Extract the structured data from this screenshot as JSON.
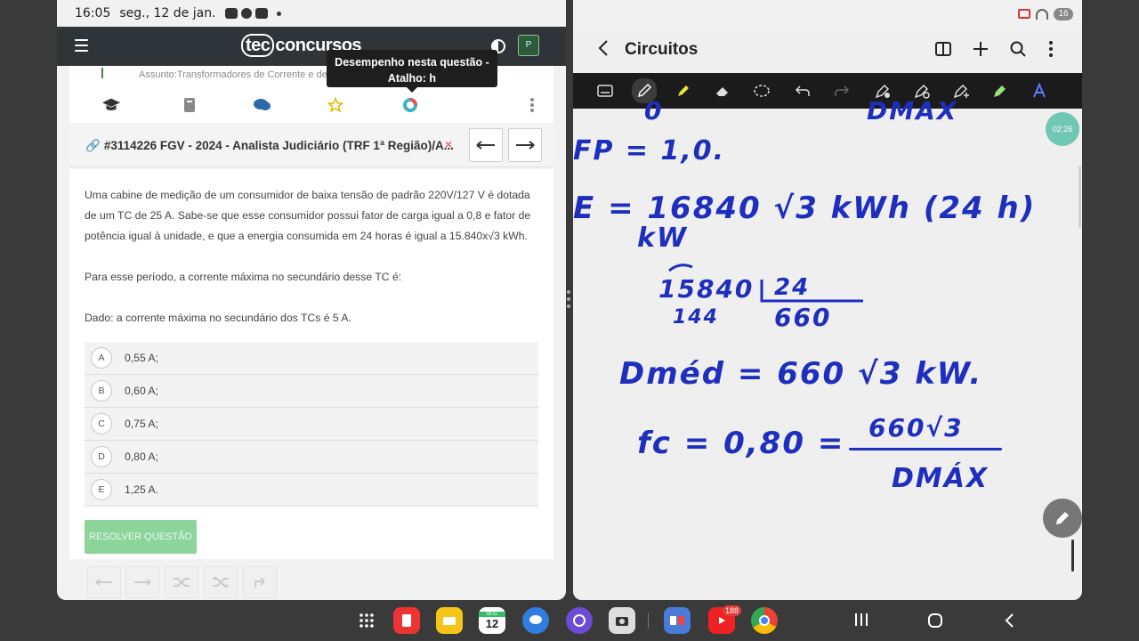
{
  "left_app": {
    "status": {
      "time": "16:05",
      "date": "seg., 12 de jan."
    },
    "brand": {
      "tec": "tec",
      "rest": "concursos"
    },
    "avatar_letter": "P",
    "tooltip": {
      "line1": "Desempenho nesta questão -",
      "line2": "Atalho: h"
    },
    "assunto": "Assunto:Transformadores de Corrente e de",
    "tab_icons": [
      "graduation-cap-icon",
      "book-icon",
      "comments-icon",
      "star-icon",
      "performance-ring-icon"
    ],
    "question": {
      "title": "#3114226 FGV - 2024 - Analista Judiciário (TRF 1ª Região)/A...",
      "close": "×",
      "paragraphs": [
        "Uma cabine de medição de um consumidor de baixa tensão de padrão 220V/127 V é dotada de um TC de 25 A. Sabe-se que esse consumidor possui fator de carga igual a 0,8 e fator de potência igual à unidade, e que a energia consumida em 24 horas é igual a 15.840x√3 kWh.",
        "Para esse período, a corrente máxima no secundário desse TC é:",
        "Dado: a corrente máxima no secundário dos TCs é 5 A."
      ],
      "alternatives": [
        {
          "letter": "A",
          "text": "0,55 A;"
        },
        {
          "letter": "B",
          "text": "0,60 A;"
        },
        {
          "letter": "C",
          "text": "0,75 A;"
        },
        {
          "letter": "D",
          "text": "0,80 A;"
        },
        {
          "letter": "E",
          "text": "1,25 A."
        }
      ],
      "resolve_label": "RESOLVER QUESTÃO"
    }
  },
  "right_app": {
    "title": "Circuitos",
    "battery": "16",
    "timer": "02:26",
    "handwriting": {
      "top_partial_left": "0",
      "top_partial_right": "DMAX",
      "fp": "FP = 1,0.",
      "energy": "E = 16840 √3 kWh (24 h)",
      "kw": "kW",
      "div_left": "15840",
      "div_right": "24",
      "div_rem": "144",
      "div_result": "660",
      "dmed": "Dméd = 660 √3 kW.",
      "fc_left": "fc = 0,80 =",
      "fc_num": "660√3",
      "fc_den": "DMÁX"
    }
  },
  "taskbar": {
    "calendar_label": "SEG.",
    "calendar_day": "12",
    "youtube_badge": "188"
  }
}
